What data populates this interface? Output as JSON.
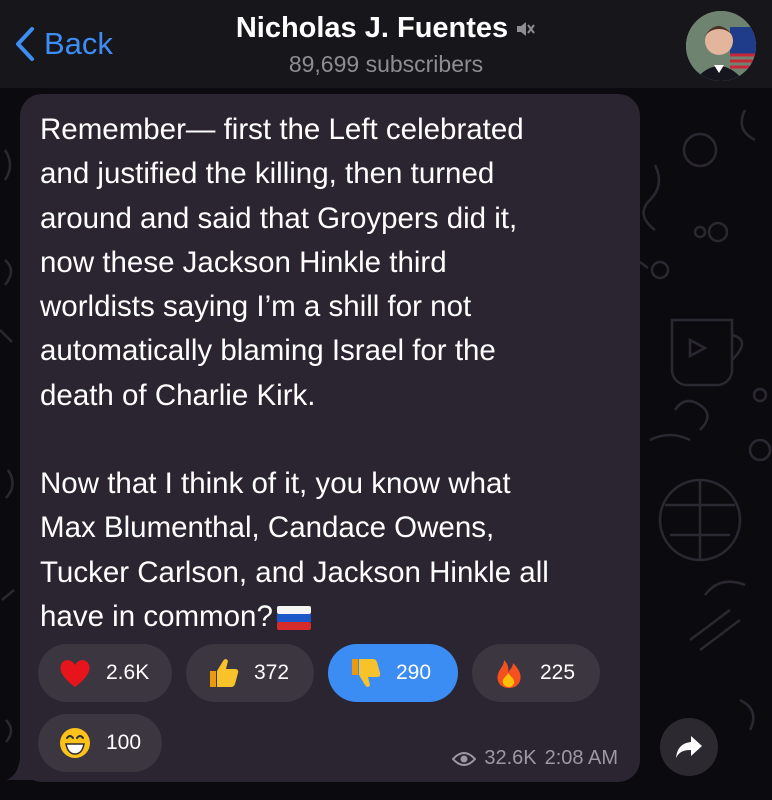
{
  "header": {
    "back_label": "Back",
    "channel_name": "Nicholas J. Fuentes",
    "subscribers": "89,699 subscribers"
  },
  "message": {
    "paragraph1": "Remember— first the Left celebrated\nand justified the killing, then turned\naround and said that Groypers did it,\nnow these Jackson Hinkle third\nworldists saying I’m a shill for not\nautomatically blaming Israel for the\ndeath of Charlie Kirk.",
    "paragraph2": "Now that I think of it, you know what\nMax Blumenthal, Candace Owens,\nTucker Carlson, and Jackson Hinkle all\nhave in common?",
    "flag_icon": "russian-flag-emoji",
    "views": "32.6K",
    "time": "2:08 AM"
  },
  "reactions": [
    {
      "icon": "red-heart-emoji",
      "count": "2.6K",
      "active": false
    },
    {
      "icon": "thumbs-up-emoji",
      "count": "372",
      "active": false
    },
    {
      "icon": "thumbs-down-emoji",
      "count": "290",
      "active": true
    },
    {
      "icon": "fire-emoji",
      "count": "225",
      "active": false
    },
    {
      "icon": "grinning-face-emoji",
      "count": "100",
      "active": false
    }
  ],
  "colors": {
    "accent": "#3d8df5",
    "bubble": "#2a2530",
    "reaction_bg": "#3b3640",
    "active_reaction": "#3c8df3"
  }
}
